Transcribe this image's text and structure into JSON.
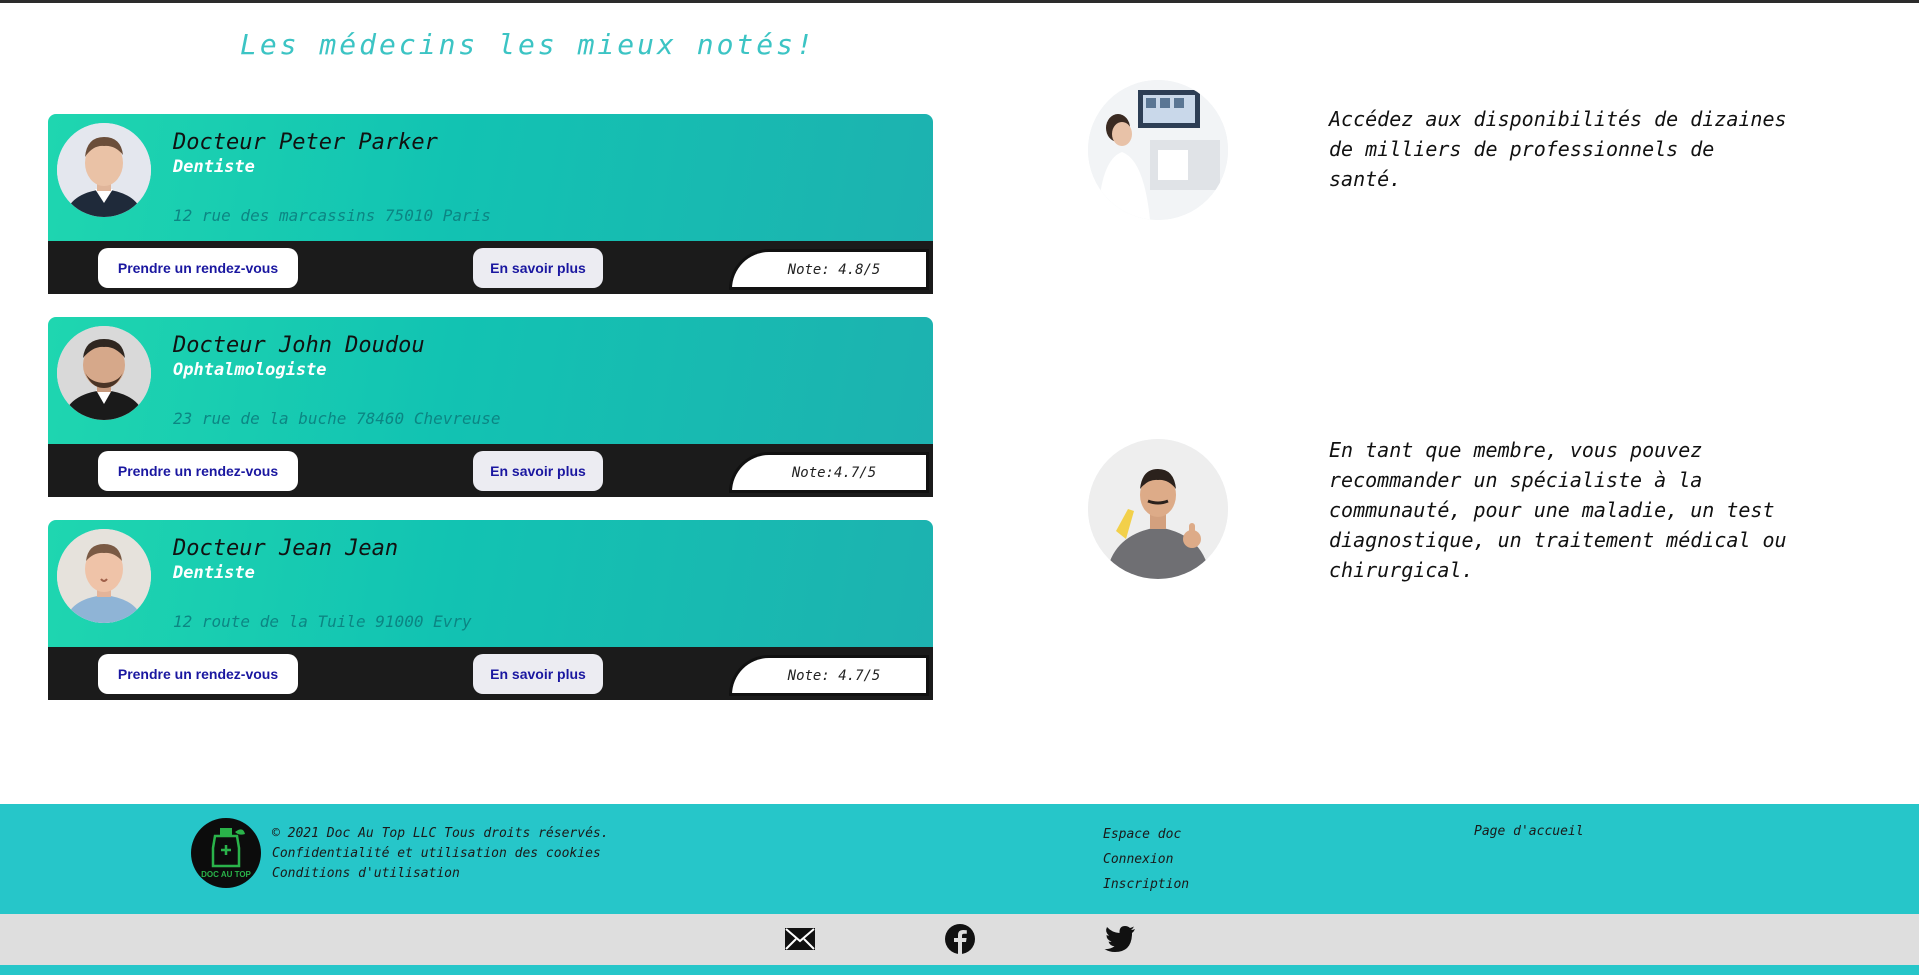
{
  "section_title": "Les médecins les mieux notés!",
  "doctors": [
    {
      "name": "Docteur Peter Parker",
      "specialty": "Dentiste",
      "address": "12 rue des marcassins 75010 Paris",
      "appointment_label": "Prendre un rendez-vous",
      "more_label": "En savoir plus",
      "rating": "Note: 4.8/5"
    },
    {
      "name": "Docteur John Doudou",
      "specialty": "Ophtalmologiste",
      "address": "23 rue de la buche 78460 Chevreuse",
      "appointment_label": "Prendre un rendez-vous",
      "more_label": "En savoir plus",
      "rating": "Note:4.7/5"
    },
    {
      "name": "Docteur Jean Jean",
      "specialty": "Dentiste",
      "address": "12 route de la Tuile 91000 Evry",
      "appointment_label": "Prendre un rendez-vous",
      "more_label": "En savoir plus",
      "rating": "Note: 4.7/5"
    }
  ],
  "features": [
    {
      "text": "Accédez aux disponibilités de dizaines de milliers de professionnels de santé."
    },
    {
      "text": "En tant que membre, vous pouvez recommander un spécialiste à la communauté, pour une maladie, un test diagnostique, un traitement médical ou chirurgical."
    }
  ],
  "footer": {
    "logo_text": "DOC AU TOP",
    "legal": [
      "© 2021 Doc Au Top LLC Tous droits réservés.",
      "Confidentialité et utilisation des cookies",
      "Conditions d'utilisation"
    ],
    "links_a": [
      "Espace doc",
      "Connexion",
      "Inscription"
    ],
    "links_b": [
      "Page d'accueil"
    ]
  },
  "social": [
    "mail-icon",
    "facebook-icon",
    "twitter-icon"
  ],
  "colors": {
    "accent": "#26c6c9",
    "title": "#3cc4c4",
    "card_dark": "#1b1b1b",
    "button_text": "#1a17a0"
  }
}
